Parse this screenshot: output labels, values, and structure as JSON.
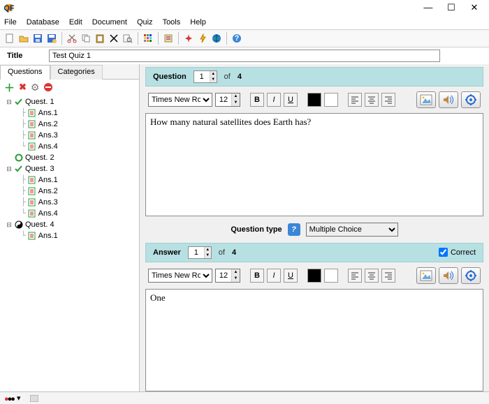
{
  "window": {
    "title": ""
  },
  "menu": [
    "File",
    "Database",
    "Edit",
    "Document",
    "Quiz",
    "Tools",
    "Help"
  ],
  "title_row": {
    "label": "Title",
    "value": "Test Quiz 1"
  },
  "tabs": {
    "questions": "Questions",
    "categories": "Categories"
  },
  "tree": {
    "questions": [
      {
        "label": "Quest. 1",
        "status": "check",
        "expanded": true,
        "answers": [
          "Ans.1",
          "Ans.2",
          "Ans.3",
          "Ans.4"
        ]
      },
      {
        "label": "Quest. 2",
        "status": "circle",
        "expanded": false,
        "answers": []
      },
      {
        "label": "Quest. 3",
        "status": "check",
        "expanded": true,
        "answers": [
          "Ans.1",
          "Ans.2",
          "Ans.3",
          "Ans.4"
        ]
      },
      {
        "label": "Quest. 4",
        "status": "yinyang",
        "expanded": true,
        "answers": [
          "Ans.1"
        ]
      }
    ]
  },
  "question": {
    "header_label": "Question",
    "index": "1",
    "of_label": "of",
    "total": "4",
    "font": "Times New Roman",
    "size": "12",
    "btn_bold": "B",
    "btn_italic": "I",
    "btn_underline": "U",
    "color_fg": "#000000",
    "color_bg": "#ffffff",
    "text": "How many natural satellites does Earth has?"
  },
  "question_type": {
    "label": "Question type",
    "value": "Multiple Choice"
  },
  "answer": {
    "header_label": "Answer",
    "index": "1",
    "of_label": "of",
    "total": "4",
    "correct_label": "Correct",
    "correct_checked": true,
    "font": "Times New Roman",
    "size": "12",
    "btn_bold": "B",
    "btn_italic": "I",
    "btn_underline": "U",
    "color_fg": "#000000",
    "color_bg": "#ffffff",
    "text": "One"
  },
  "icons": {
    "plus": "+",
    "x": "✕",
    "gear": "⚙",
    "minus": "⊖"
  }
}
